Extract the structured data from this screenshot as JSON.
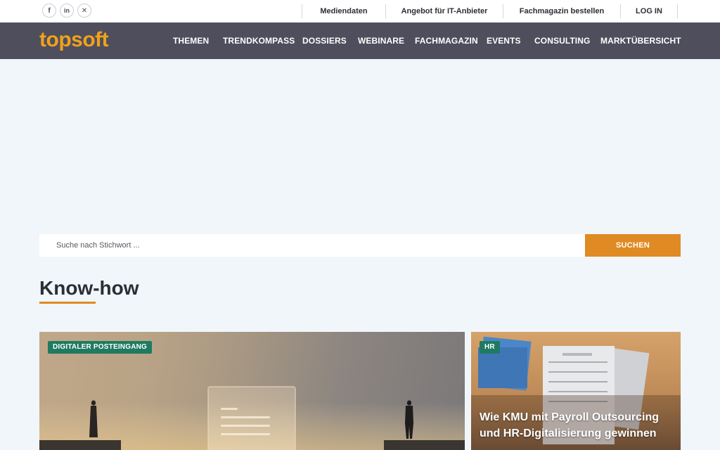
{
  "social": {
    "facebook_glyph": "f",
    "linkedin_glyph": "in",
    "xing_glyph": "✕"
  },
  "utility_links": [
    {
      "label": "Mediendaten"
    },
    {
      "label": "Angebot für IT-Anbieter"
    },
    {
      "label": "Fachmagazin bestellen"
    },
    {
      "label": "LOG IN"
    }
  ],
  "brand": {
    "logo_text": "topsoft",
    "logo_color": "#f0a11d",
    "nav_bg": "#4e4e5d",
    "accent": "#e08a23"
  },
  "nav": {
    "items": [
      {
        "label": "THEMEN"
      },
      {
        "label": "TRENDKOMPASS"
      },
      {
        "label": "DOSSIERS"
      },
      {
        "label": "WEBINARE"
      },
      {
        "label": "FACHMAGAZIN"
      },
      {
        "label": "EVENTS"
      },
      {
        "label": "CONSULTING"
      },
      {
        "label": "MARKTÜBERSICHT"
      }
    ]
  },
  "search": {
    "placeholder": "Suche nach Stichwort ...",
    "value": "",
    "button_label": "SUCHEN"
  },
  "section": {
    "title": "Know-how"
  },
  "cards": [
    {
      "badge": "DIGITALER POSTEINGANG",
      "badge_color": "#1f7a62"
    },
    {
      "badge": "HR",
      "badge_color": "#1f7a62",
      "headline": "Wie KMU mit Payroll Outsourcing und HR-Digitalisierung gewinnen"
    }
  ]
}
